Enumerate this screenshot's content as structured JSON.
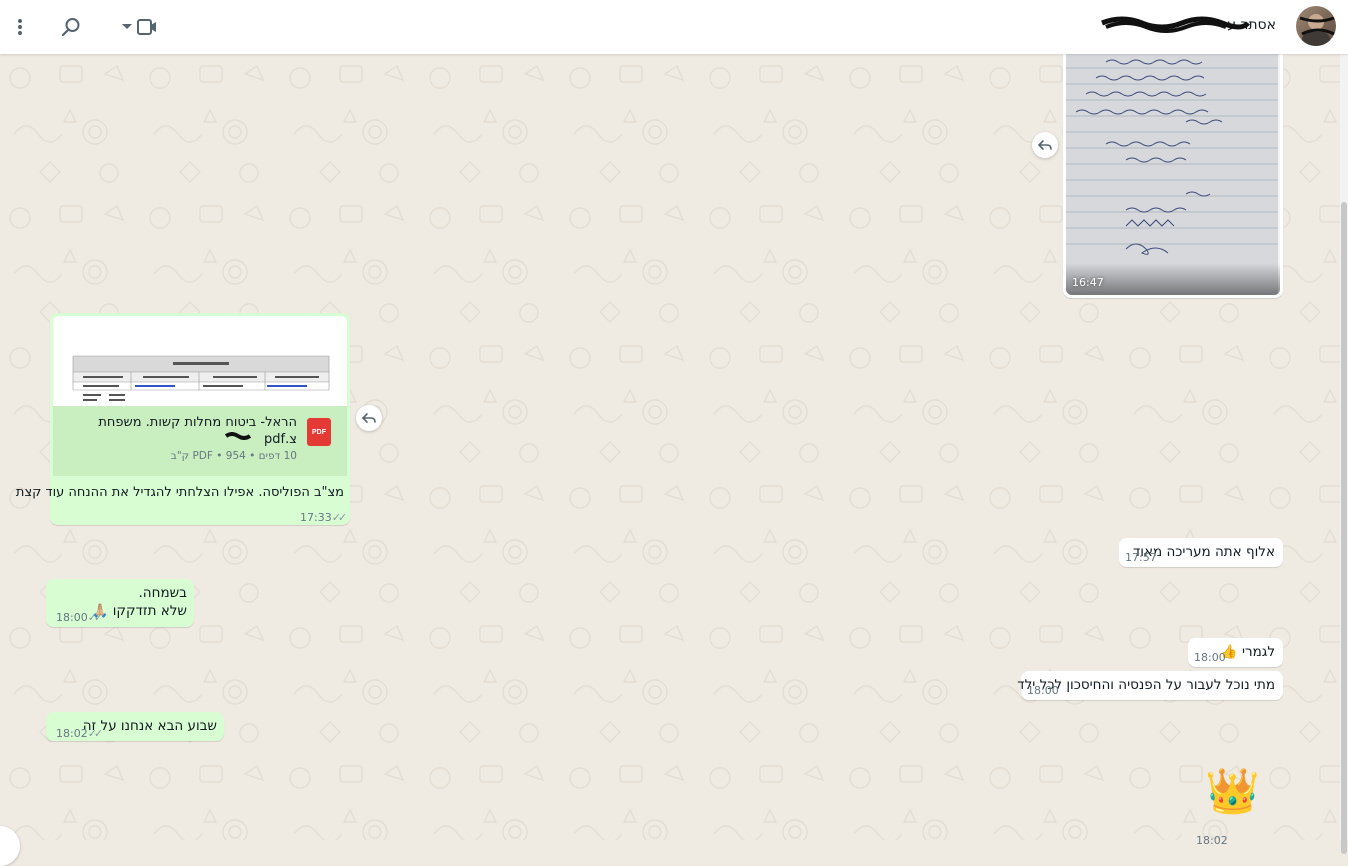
{
  "header": {
    "contact_name": "אסתר ע",
    "icons": [
      "kebab-menu-icon",
      "search-icon",
      "video-camera-icon",
      "dropdown-arrow-icon"
    ]
  },
  "colors": {
    "chat_background": "#efeae2",
    "outgoing_bubble": "#d9fdd3",
    "incoming_bubble": "#ffffff",
    "timestamp": "#667781"
  },
  "messages": {
    "photo": {
      "time": "16:47"
    },
    "document": {
      "title": "הראל- ביטוח מחלות קשות. משפחת צ",
      "title_ext": ".pdf",
      "meta": "10 דפים • PDF • 954 ק\"ב",
      "caption": "מצ\"ב הפוליסה. אפילו הצלחתי להגדיל את ההנחה עוד קצת",
      "time": "17:33"
    },
    "msg1": {
      "text": "אלוף אתה מעריכה מאוד",
      "time": "17:57"
    },
    "msg2": {
      "line1": "בשמחה.",
      "line2": "שלא תזדקקו 🙏🏼",
      "time": "18:00"
    },
    "msg3": {
      "text": "לגמרי 👍",
      "time": "18:00"
    },
    "msg4": {
      "text": "מתי נוכל לעבור על הפנסיה והחיסכון לכל ילד",
      "time": "18:00"
    },
    "msg5": {
      "text": "שבוע הבא אנחנו על זה",
      "time": "18:02"
    },
    "msg6": {
      "emoji": "👑",
      "time": "18:02"
    }
  }
}
